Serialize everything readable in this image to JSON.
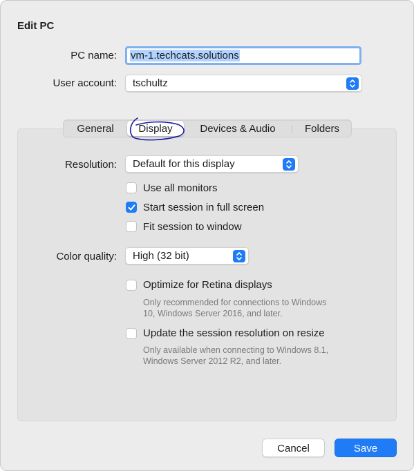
{
  "dialog": {
    "title": "Edit PC"
  },
  "pc_name": {
    "label": "PC name:",
    "value": "vm-1.techcats.solutions"
  },
  "user_account": {
    "label": "User account:",
    "value": "tschultz"
  },
  "tabs": [
    {
      "label": "General",
      "active": false
    },
    {
      "label": "Display",
      "active": true
    },
    {
      "label": "Devices & Audio",
      "active": false
    },
    {
      "label": "Folders",
      "active": false
    }
  ],
  "display": {
    "resolution_label": "Resolution:",
    "resolution_value": "Default for this display",
    "use_all_monitors": {
      "label": "Use all monitors",
      "checked": false
    },
    "full_screen": {
      "label": "Start session in full screen",
      "checked": true
    },
    "fit_to_window": {
      "label": "Fit session to window",
      "checked": false
    },
    "color_quality_label": "Color quality:",
    "color_quality_value": "High (32 bit)",
    "retina": {
      "label": "Optimize for Retina displays",
      "checked": false,
      "help_line1": "Only recommended for connections to Windows",
      "help_line2": "10, Windows Server 2016, and later."
    },
    "resize": {
      "label": "Update the session resolution on resize",
      "checked": false,
      "help_line1": "Only available when connecting to Windows 8.1,",
      "help_line2": "Windows Server 2012 R2, and later."
    }
  },
  "buttons": {
    "cancel": "Cancel",
    "save": "Save"
  },
  "colors": {
    "accent": "#1f7cf6",
    "annotation": "#1a1aa8"
  },
  "icons": {
    "popup": "chevron-up-down-icon",
    "check": "checkmark-icon"
  }
}
